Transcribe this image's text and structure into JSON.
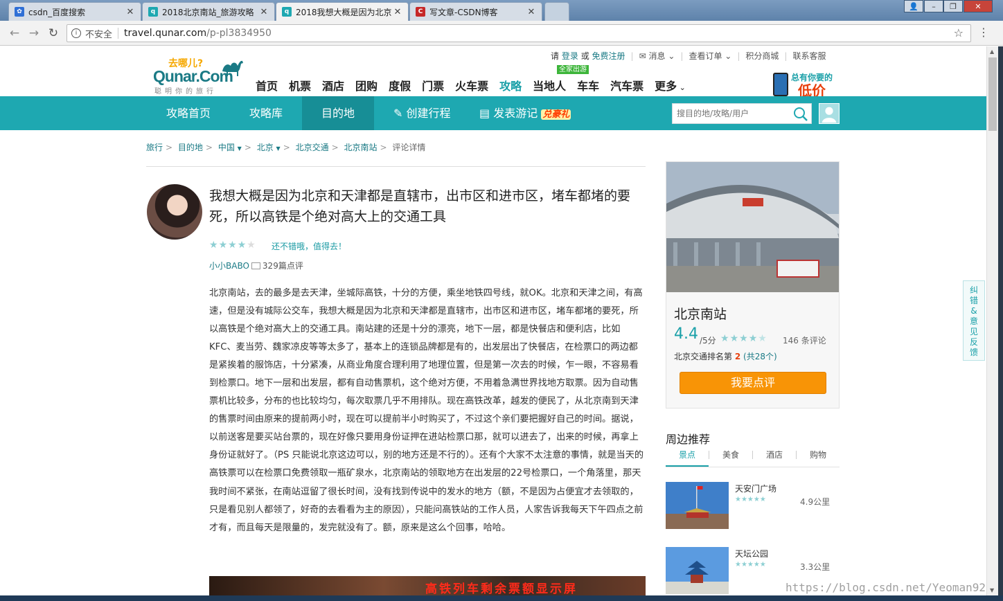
{
  "browser": {
    "tabs": [
      {
        "label": "csdn_百度搜索",
        "favicon": "baidu-paw"
      },
      {
        "label": "2018北京南站_旅游攻略",
        "favicon": "qunar"
      },
      {
        "label": "2018我想大概是因为北京",
        "favicon": "qunar",
        "active": true
      },
      {
        "label": "写文章-CSDN博客",
        "favicon": "csdn"
      }
    ],
    "insecure_label": "不安全",
    "url_host": "travel.qunar.com",
    "url_path": "/p-pl3834950"
  },
  "header": {
    "logo_tagline": "去哪儿?",
    "logo_brand": "Qunar.Com",
    "logo_slogan": "聪明你的旅行",
    "topbar": {
      "please": "请",
      "login": "登录",
      "or": "或",
      "register": "免费注册",
      "messages": "消息",
      "orders": "查看订单",
      "points_mall": "积分商城",
      "support": "联系客服"
    },
    "nav": [
      "首页",
      "机票",
      "酒店",
      "团购",
      "度假",
      "门票",
      "火车票",
      "攻略",
      "当地人",
      "车车",
      "汽车票",
      "更多"
    ],
    "nav_badge": "全家出游",
    "promo_line1": "总有你要的",
    "promo_line2": "低价"
  },
  "subnav": {
    "items": [
      "攻略首页",
      "攻略库",
      "目的地",
      "创建行程",
      "发表游记"
    ],
    "gift": "兑豪礼",
    "search_placeholder": "搜目的地/攻略/用户"
  },
  "breadcrumb": [
    "旅行",
    "目的地",
    "中国",
    "北京",
    "北京交通",
    "北京南站",
    "评论详情"
  ],
  "review": {
    "title": "我想大概是因为北京和天津都是直辖市，出市区和进市区，堵车都堵的要死，所以高铁是个绝对高大上的交通工具",
    "rating": 4,
    "rating_max": 5,
    "rating_note": "还不错哦，值得去！",
    "author": "小小BABO",
    "author_reviews": "329篇点评",
    "body": "北京南站，去的最多是去天津，坐城际高铁，十分的方便，乘坐地铁四号线，就OK。北京和天津之间，有高速，但是没有城际公交车，我想大概是因为北京和天津都是直辖市，出市区和进市区，堵车都堵的要死，所以高铁是个绝对高大上的交通工具。南站建的还是十分的漂亮，地下一层，都是快餐店和便利店，比如KFC、麦当劳、魏家凉皮等等太多了，基本上的连锁品牌都是有的，出发层出了快餐店，在检票口的两边都是紧挨着的服饰店，十分紧凑，从商业角度合理利用了地理位置，但是第一次去的时候，乍一眼，不容易看到检票口。地下一层和出发层，都有自动售票机，这个绝对方便，不用着急满世界找地方取票。因为自动售票机比较多，分布的也比较均匀，每次取票几乎不用排队。现在高铁改革，越发的便民了，从北京南到天津的售票时间由原来的提前两小时，现在可以提前半小时购买了，不过这个亲们要把握好自己的时间。据说，以前送客是要买站台票的，现在好像只要用身份证押在进站检票口那，就可以进去了，出来的时候，再拿上身份证就好了。（PS 只能说北京这边可以，别的地方还是不行的）。还有个大家不太注意的事情，就是当天的高铁票可以在检票口免费领取一瓶矿泉水，北京南站的领取地方在出发层的22号检票口，一个角落里，那天我时间不紧张，在南站逗留了很长时间，没有找到传说中的发水的地方（额，不是因为占便宜才去领取的，只是看见别人都领了，好奇的去看看为主的原因），只能问高铁站的工作人员，人家告诉我每天下午四点之前才有，而且每天是限量的，发完就没有了。额，原来是这么个回事，哈哈。",
    "photo_caption": "高铁列车剩余票额显示屏"
  },
  "poi": {
    "name": "北京南站",
    "score": "4.4",
    "score_unit": "/5分",
    "stars": 4.5,
    "comments": "146 条评论",
    "rank_label": "北京交通排名第",
    "rank": "2",
    "rank_total": "(共28个)",
    "button": "我要点评"
  },
  "nearby": {
    "title": "周边推荐",
    "tabs": [
      "景点",
      "美食",
      "酒店",
      "购物"
    ],
    "items": [
      {
        "name": "天安门广场",
        "distance": "4.9公里"
      },
      {
        "name": "天坛公园",
        "distance": "3.3公里"
      }
    ]
  },
  "feedback_label": "纠错&意见反馈",
  "watermark": "https://blog.csdn.net/Yeoman92",
  "colors": {
    "brand": "#1ea8b1",
    "accent": "#f89406",
    "link": "#1a7a85"
  }
}
